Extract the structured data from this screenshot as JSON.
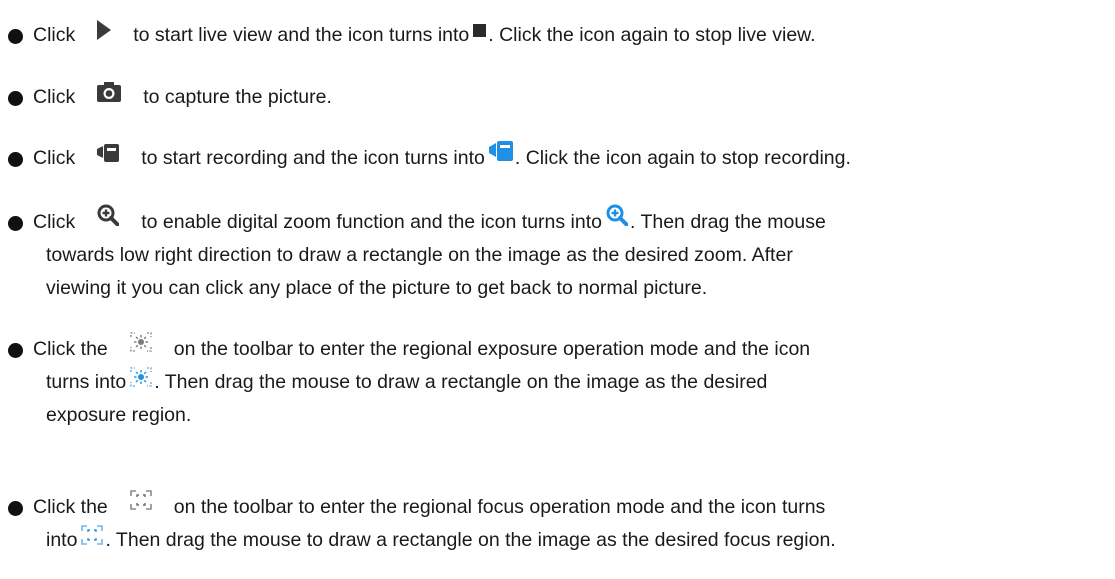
{
  "items": [
    {
      "lines": [
        {
          "before": "Click",
          "icon1": "play-icon",
          "middle": "to start live view and the icon turns into",
          "icon2": "stop-icon",
          "after": ". Click the icon again to stop live view."
        }
      ]
    },
    {
      "lines": [
        {
          "before": "Click",
          "icon1": "camera-snapshot-icon",
          "after": "to capture the picture."
        }
      ]
    },
    {
      "lines": [
        {
          "before": "Click",
          "icon1": "record-icon",
          "middle": "to start recording and the icon turns into",
          "icon2": "record-active-icon",
          "after": ". Click the icon again to stop recording."
        }
      ]
    },
    {
      "lines": [
        {
          "before": "Click",
          "icon1": "zoom-in-icon",
          "middle": "to enable digital zoom function and the icon turns into",
          "icon2": "zoom-in-active-icon",
          "after": ". Then drag the mouse"
        },
        {
          "text": "towards low right direction to draw a rectangle on the image as the desired zoom. After"
        },
        {
          "text": "viewing it you can click any place of the picture to get back to normal picture."
        }
      ]
    },
    {
      "lines": [
        {
          "before": "Click the",
          "icon1": "regional-exposure-icon",
          "after": "on the toolbar to enter the regional exposure operation mode and the icon"
        },
        {
          "before": "turns into",
          "icon1": "regional-exposure-active-icon",
          "after": ". Then drag the mouse to draw a rectangle on the image as the desired"
        },
        {
          "text": "exposure region."
        }
      ]
    },
    {
      "lines": [
        {
          "before": "Click the",
          "icon1": "regional-focus-icon",
          "after": "on the toolbar to enter the regional focus operation mode and the icon turns"
        },
        {
          "before": "into",
          "icon1": "regional-focus-active-icon",
          "after": ". Then drag the mouse to draw a rectangle on the image as the desired focus region."
        }
      ]
    }
  ],
  "colors": {
    "text": "#1a1a1a",
    "icon_dark": "#3a3a3a",
    "icon_active": "#1e90e6",
    "icon_light": "#9a9a9a"
  }
}
